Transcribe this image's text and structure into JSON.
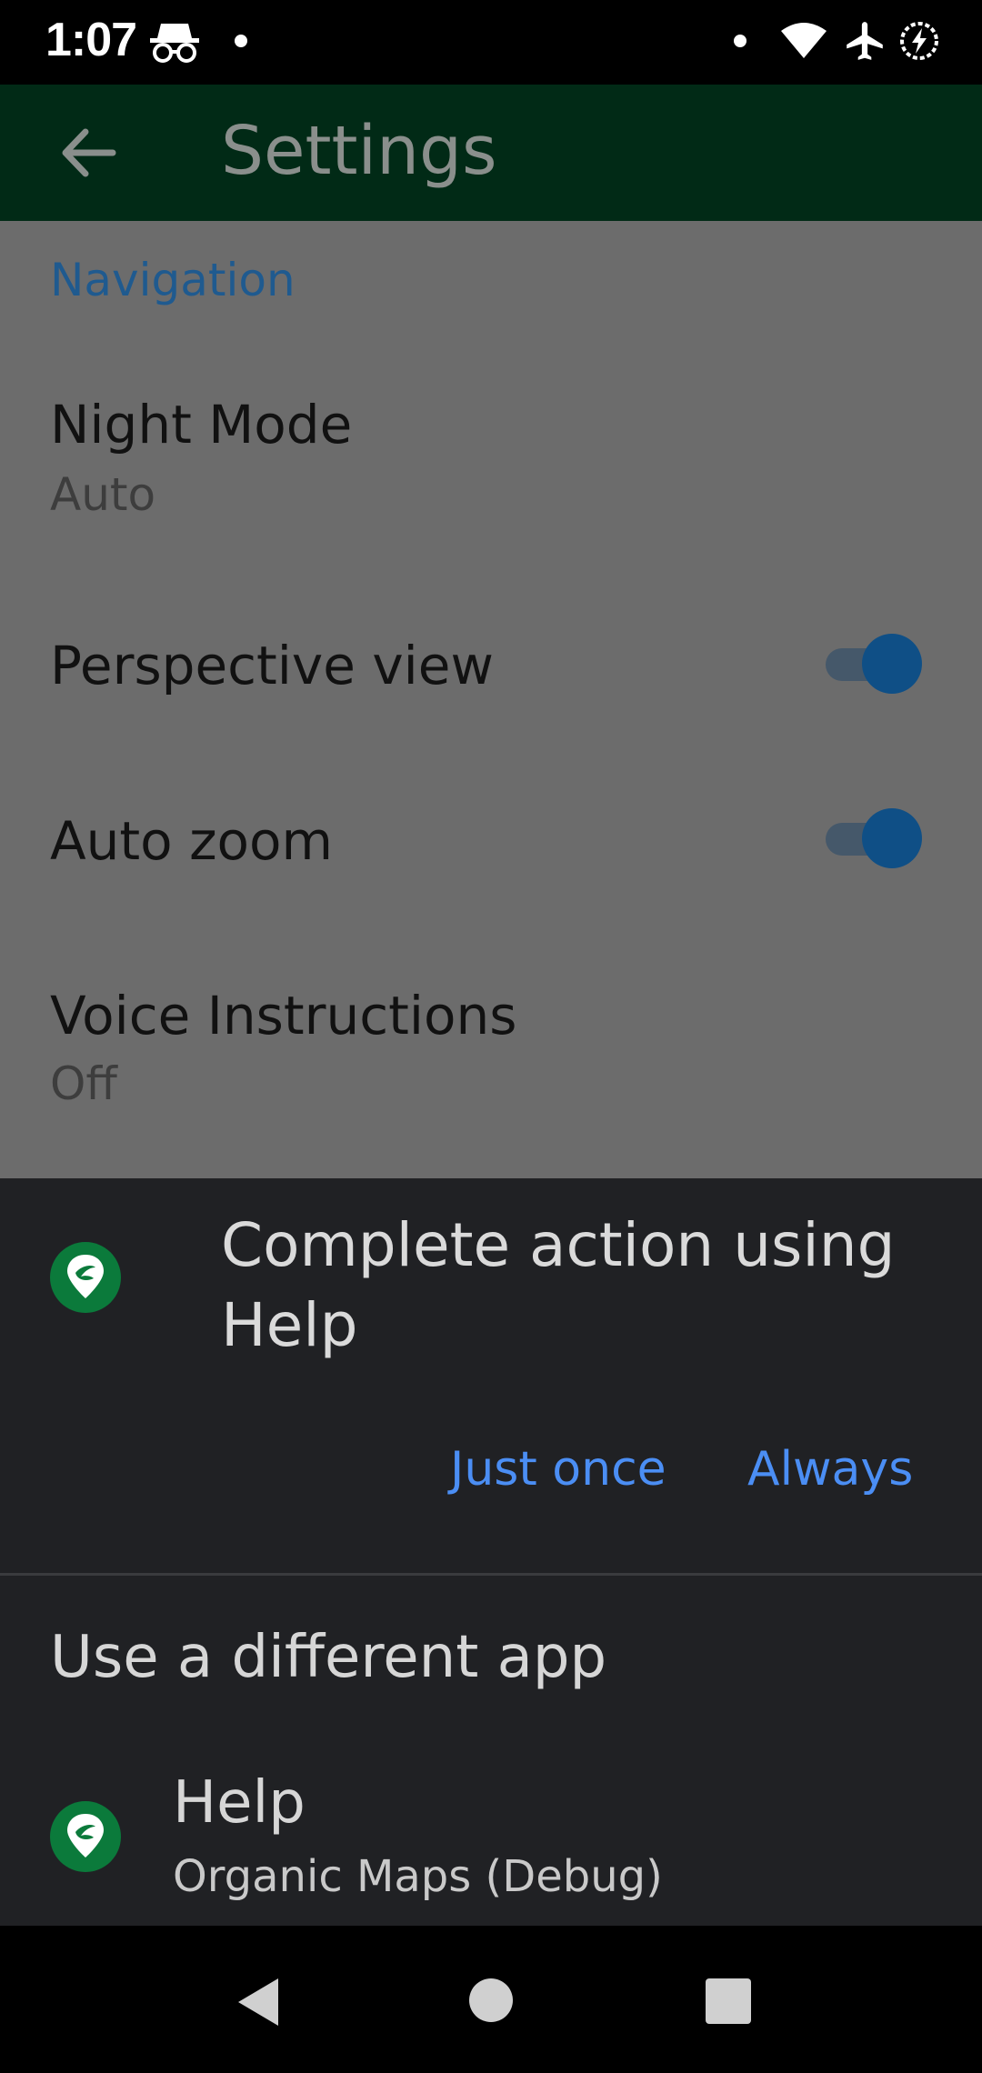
{
  "status_bar": {
    "time": "1:07",
    "icons": [
      "incognito-icon",
      "notification-dot-icon",
      "dot-icon",
      "wifi-icon",
      "airplane-mode-icon",
      "battery-saver-icon"
    ]
  },
  "toolbar": {
    "title": "Settings",
    "back_icon": "arrow-left-icon"
  },
  "settings": {
    "section_title": "Navigation",
    "night_mode": {
      "title": "Night Mode",
      "value": "Auto"
    },
    "perspective_view": {
      "title": "Perspective view",
      "enabled": true
    },
    "auto_zoom": {
      "title": "Auto zoom",
      "enabled": true
    },
    "voice_instructions": {
      "title": "Voice Instructions",
      "value": "Off"
    }
  },
  "chooser": {
    "heading": "Complete action using Help",
    "just_once_label": "Just once",
    "always_label": "Always",
    "other_label": "Use a different app",
    "app": {
      "name": "Help",
      "package_label": "Organic Maps (Debug)"
    }
  },
  "nav_bar": {
    "icons": [
      "back-triangle-icon",
      "home-circle-icon",
      "recents-square-icon"
    ]
  },
  "colors": {
    "toolbar_bg": "#012a16",
    "content_scrim": "#6c6c6c",
    "sheet_bg": "#202124",
    "accent_blue": "#4b8ef4",
    "toggle_thumb": "#0f4f86",
    "section_blue": "#1f5a8f"
  }
}
